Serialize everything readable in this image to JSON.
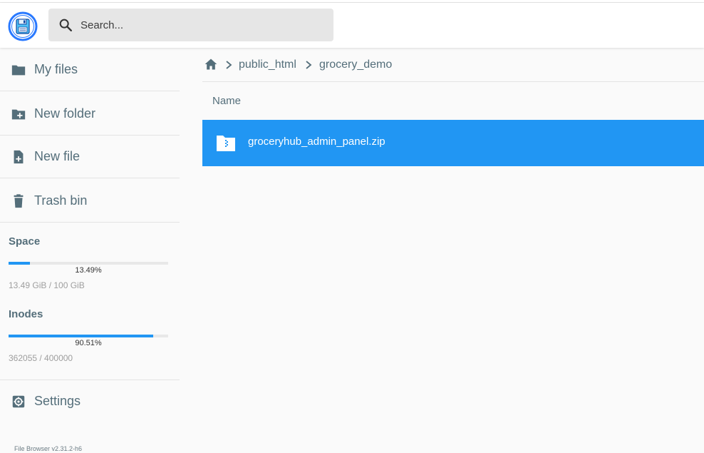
{
  "header": {
    "search_placeholder": "Search..."
  },
  "sidebar": {
    "items": [
      {
        "label": "My files",
        "icon": "folder-icon"
      },
      {
        "label": "New folder",
        "icon": "folder-plus-icon"
      },
      {
        "label": "New file",
        "icon": "file-plus-icon"
      },
      {
        "label": "Trash bin",
        "icon": "trash-icon"
      }
    ],
    "space": {
      "title": "Space",
      "percent_label": "13.49%",
      "percent": 13.49,
      "usage": "13.49 GiB / 100 GiB"
    },
    "inodes": {
      "title": "Inodes",
      "percent_label": "90.51%",
      "percent": 90.51,
      "usage": "362055 / 400000"
    },
    "settings_label": "Settings",
    "version": "File Browser v2.31.2-h6"
  },
  "breadcrumb": {
    "items": [
      "public_html",
      "grocery_demo"
    ]
  },
  "listing": {
    "column_name": "Name",
    "files": [
      {
        "name": "groceryhub_admin_panel.zip",
        "icon": "zip-folder-icon",
        "selected": true
      }
    ]
  },
  "colors": {
    "accent": "#2196f3",
    "sidebar_text": "#546e7a"
  }
}
